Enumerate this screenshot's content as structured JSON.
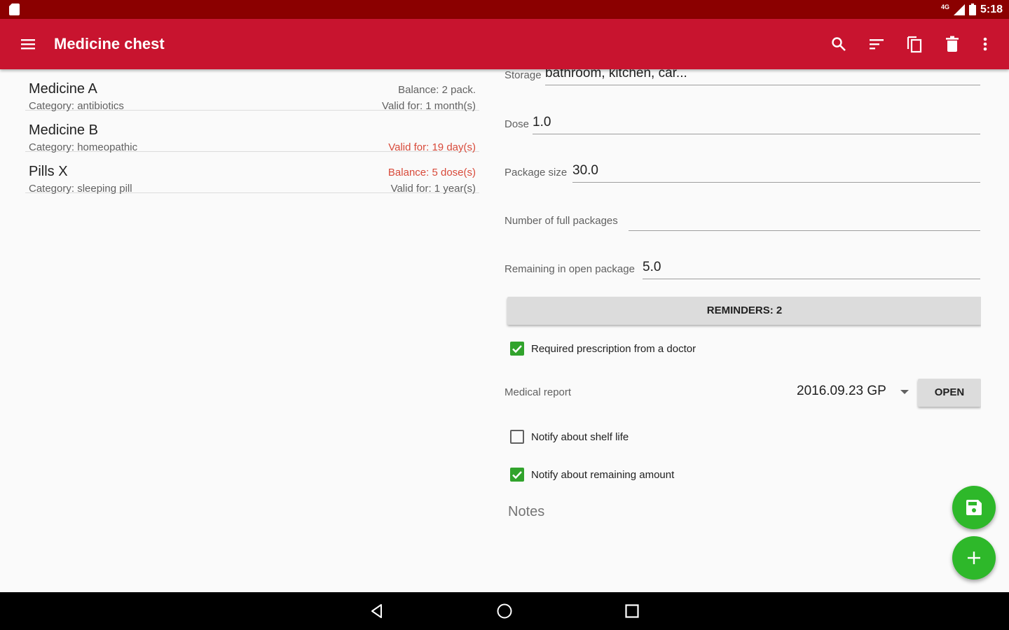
{
  "status_bar": {
    "time": "5:18",
    "network": "4G"
  },
  "app_bar": {
    "title": "Medicine chest",
    "icons": [
      "menu-icon",
      "search-icon",
      "sort-icon",
      "copy-icon",
      "delete-icon",
      "more-vert-icon"
    ],
    "color": "#c8142f"
  },
  "medicines": [
    {
      "name": "Medicine A",
      "category": "Category: antibiotics",
      "balance": "Balance: 2 pack.",
      "validity": "Valid for: 1 month(s)",
      "balance_warn": false,
      "validity_warn": false
    },
    {
      "name": "Medicine B",
      "category": "Category: homeopathic",
      "balance": "",
      "validity": "Valid for: 19 day(s)",
      "balance_warn": false,
      "validity_warn": true
    },
    {
      "name": "Pills X",
      "category": "Category: sleeping pill",
      "balance": "Balance: 5 dose(s)",
      "validity": "Valid for: 1 year(s)",
      "balance_warn": true,
      "validity_warn": false
    }
  ],
  "form": {
    "storage": {
      "label": "Storage",
      "value": "bathroom, kitchen, car..."
    },
    "dose": {
      "label": "Dose",
      "value": "1.0"
    },
    "package_size": {
      "label": "Package size",
      "value": "30.0"
    },
    "full_packages": {
      "label": "Number of full packages",
      "value": ""
    },
    "remaining": {
      "label": "Remaining in open package",
      "value": "5.0"
    },
    "reminders_button": "REMINDERS: 2",
    "prescription": {
      "label": "Required prescription from a doctor",
      "checked": true
    },
    "medical_report": {
      "label": "Medical report",
      "value": "2016.09.23 GP",
      "open_button": "OPEN"
    },
    "notify_shelf": {
      "label": "Notify about shelf life",
      "checked": false
    },
    "notify_remaining": {
      "label": "Notify about remaining amount",
      "checked": true
    },
    "notes_placeholder": "Notes"
  },
  "fabs": {
    "save_icon": "save-icon",
    "add_icon": "add-icon",
    "color": "#2eb82a"
  },
  "nav_bar": {
    "icons": [
      "back-icon",
      "home-icon",
      "recents-icon"
    ]
  }
}
